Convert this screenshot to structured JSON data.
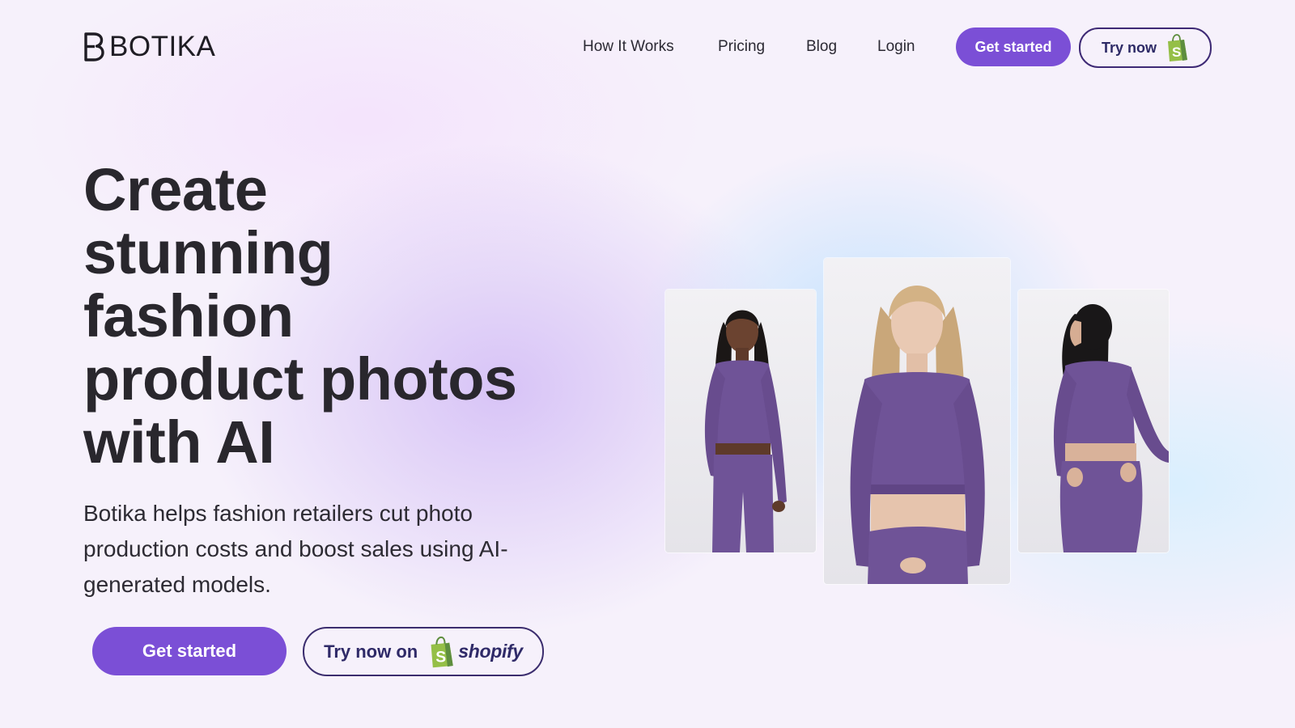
{
  "brand": {
    "name": "BOTIKA",
    "logo_icon": "botika-b-logo"
  },
  "nav": {
    "items": [
      {
        "label": "How It Works"
      },
      {
        "label": "Pricing"
      },
      {
        "label": "Blog"
      },
      {
        "label": "Login"
      }
    ]
  },
  "header_actions": {
    "get_started_label": "Get started",
    "try_now_label": "Try now",
    "try_now_icon": "shopify-bag-icon"
  },
  "hero": {
    "title_lines": [
      "Create",
      "stunning",
      "fashion",
      "product photos",
      "with AI"
    ],
    "subtitle": "Botika helps fashion retailers cut photo production costs and boost sales using AI-generated models.",
    "primary_cta": "Get started",
    "secondary_cta": "Try now on",
    "secondary_cta_brand": "shopify"
  },
  "gallery": {
    "images": [
      {
        "subject": "model-front-dark-hair"
      },
      {
        "subject": "model-front-blonde"
      },
      {
        "subject": "model-back-dark-hair"
      }
    ]
  },
  "colors": {
    "accent": "#7b4fd6",
    "outline": "#3b2d6e",
    "text": "#29272d",
    "outfit": "#6f5397",
    "shopify_green": "#95bf47"
  }
}
